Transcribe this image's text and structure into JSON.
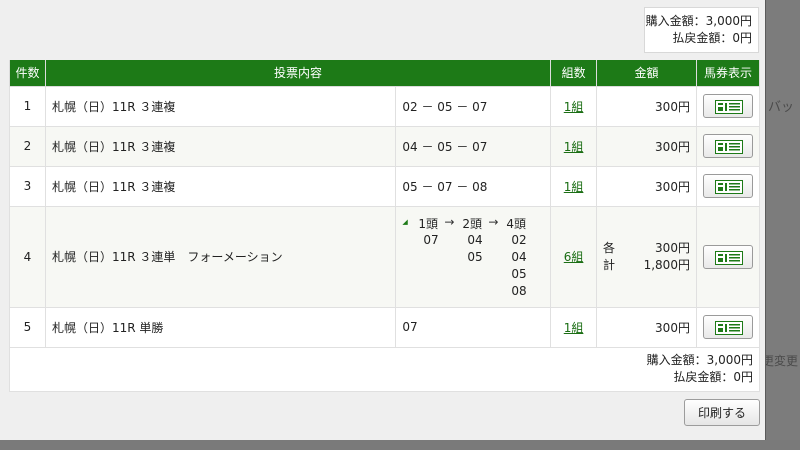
{
  "background": {
    "partial_text_1": "バッ",
    "partial_text_2": "更変更"
  },
  "summary_top": {
    "purchase": "購入金額：3,000円",
    "refund": "払戻金額：0円"
  },
  "table": {
    "headers": {
      "num": "件数",
      "content": "投票内容",
      "kumi": "組数",
      "amount": "金額",
      "ticket": "馬券表示"
    },
    "rows": [
      {
        "num": "1",
        "race": "札幌（日）11R ３連複",
        "combo": "02 － 05 － 07",
        "kumi": "1組",
        "amount": "300円"
      },
      {
        "num": "2",
        "race": "札幌（日）11R ３連複",
        "combo": "04 － 05 － 07",
        "kumi": "1組",
        "amount": "300円"
      },
      {
        "num": "3",
        "race": "札幌（日）11R ３連複",
        "combo": "05 － 07 － 08",
        "kumi": "1組",
        "amount": "300円"
      },
      {
        "num": "4",
        "race": "札幌（日）11R ３連単　フォーメーション",
        "formation": {
          "h1": "1頭",
          "h2": "2頭",
          "h3": "4頭",
          "arrow": "→",
          "col1": [
            "07"
          ],
          "col2": [
            "04",
            "05"
          ],
          "col3": [
            "02",
            "04",
            "05",
            "08"
          ]
        },
        "kumi": "6組",
        "amount_each_label": "各",
        "amount_total_label": "計",
        "amount_each": "300円",
        "amount_total": "1,800円"
      },
      {
        "num": "5",
        "race": "札幌（日）11R 単勝",
        "combo": "07",
        "kumi": "1組",
        "amount": "300円"
      }
    ]
  },
  "summary_bottom": {
    "purchase": "購入金額：3,000円",
    "refund": "払戻金額：0円"
  },
  "print_button": "印刷する",
  "colors": {
    "header_green": "#1d7a17",
    "link_green": "#1b6e14"
  }
}
